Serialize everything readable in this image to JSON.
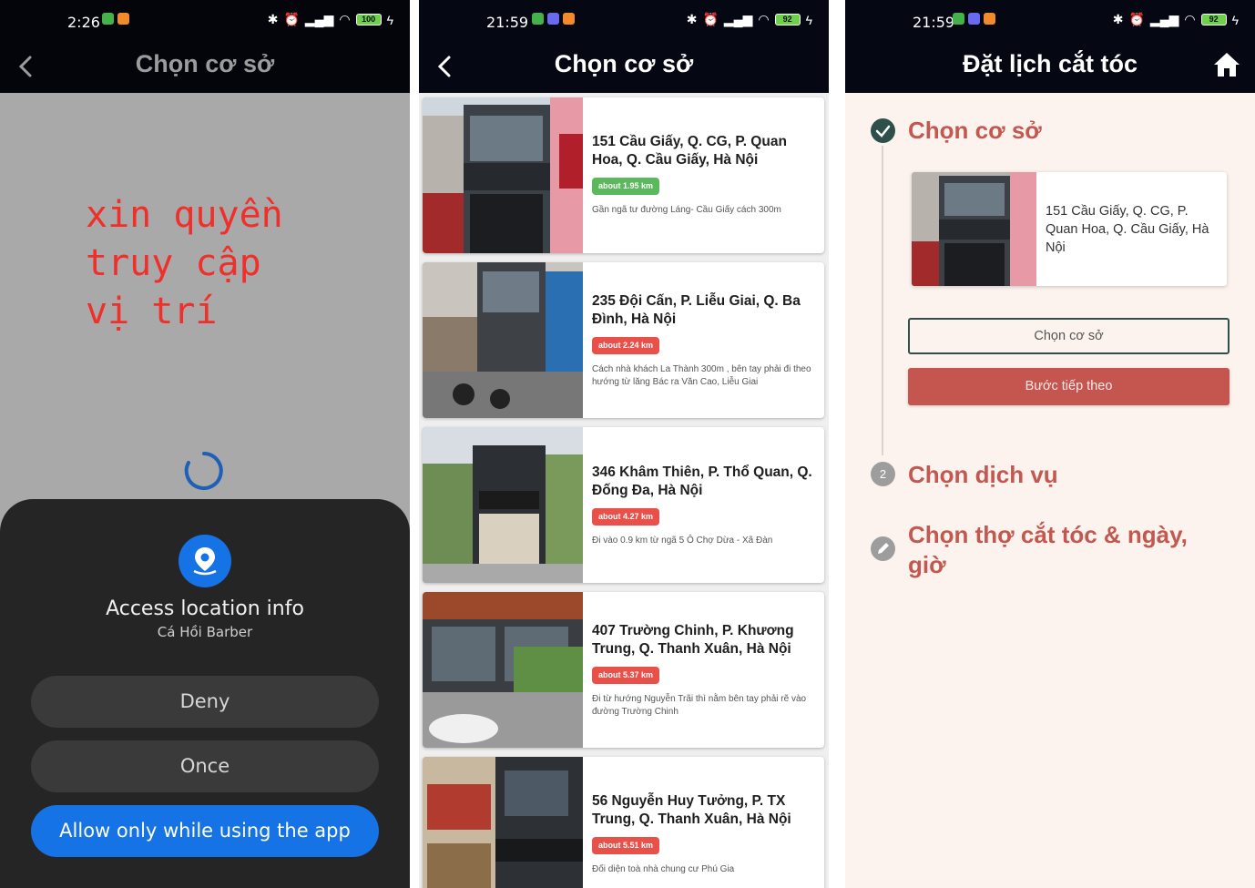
{
  "colors": {
    "appbar_bg": "#050812",
    "brand_red": "#c4564f",
    "step_done_green": "#2f4f4a",
    "android_blue": "#1673e6",
    "badge_green": "#5cb85c",
    "badge_red": "#e8504a"
  },
  "screen1": {
    "status_time": "2:26",
    "battery": "100",
    "title": "Chọn cơ sở",
    "overlay_text": "xin quyền\ntruy cập\nvị trí",
    "permission": {
      "icon": "location-pin-icon",
      "title": "Access location info",
      "app_name": "Cá Hồi Barber",
      "deny_label": "Deny",
      "once_label": "Once",
      "allow_label": "Allow only while using the app"
    }
  },
  "screen2": {
    "status_time": "21:59",
    "battery": "92",
    "title": "Chọn cơ sở",
    "branches": [
      {
        "address": "151 Cầu Giấy, Q. CG, P. Quan Hoa, Q. Cầu Giấy, Hà Nội",
        "distance": "about 1.95 km",
        "badge_color": "#5cb85c",
        "note": "Gần ngã tư đường Láng- Cầu Giấy cách 300m"
      },
      {
        "address": "235 Đội Cấn, P. Liễu Giai, Q. Ba Đình, Hà Nội",
        "distance": "about 2.24 km",
        "badge_color": "#e8504a",
        "note": "Cách nhà khách La Thành 300m , bên tay phải đi theo hướng từ lăng Bác ra Văn Cao, Liễu Giai"
      },
      {
        "address": "346 Khâm Thiên, P. Thổ Quan, Q. Đống Đa, Hà Nội",
        "distance": "about 4.27 km",
        "badge_color": "#e8504a",
        "note": "Đi vào 0.9 km từ ngã 5 Ô Chợ Dừa - Xã Đàn"
      },
      {
        "address": "407 Trường Chinh, P. Khương Trung, Q. Thanh Xuân, Hà Nội",
        "distance": "about 5.37 km",
        "badge_color": "#e8504a",
        "note": "Đi từ hướng Nguyễn Trãi thì nằm bên tay phải rẽ vào đường Trường Chinh"
      },
      {
        "address": "56 Nguyễn Huy Tưởng, P. TX Trung, Q. Thanh Xuân, Hà Nội",
        "distance": "about 5.51 km",
        "badge_color": "#e8504a",
        "note": "Đối diện toà nhà chung cư Phú Gia"
      }
    ]
  },
  "screen3": {
    "status_time": "21:59",
    "battery": "92",
    "title": "Đặt lịch cắt tóc",
    "home_icon": "home-icon",
    "step1": {
      "title": "Chọn cơ sở",
      "icon": "check-icon"
    },
    "selected_address": "151 Cầu Giấy, Q. CG, P. Quan Hoa, Q. Cầu Giấy, Hà Nội",
    "choose_button": "Chọn cơ sở",
    "next_button": "Bước tiếp theo",
    "step2": {
      "number": "2",
      "title": "Chọn dịch vụ"
    },
    "step3": {
      "title": "Chọn thợ cắt tóc & ngày, giờ",
      "icon": "pencil-icon"
    }
  }
}
